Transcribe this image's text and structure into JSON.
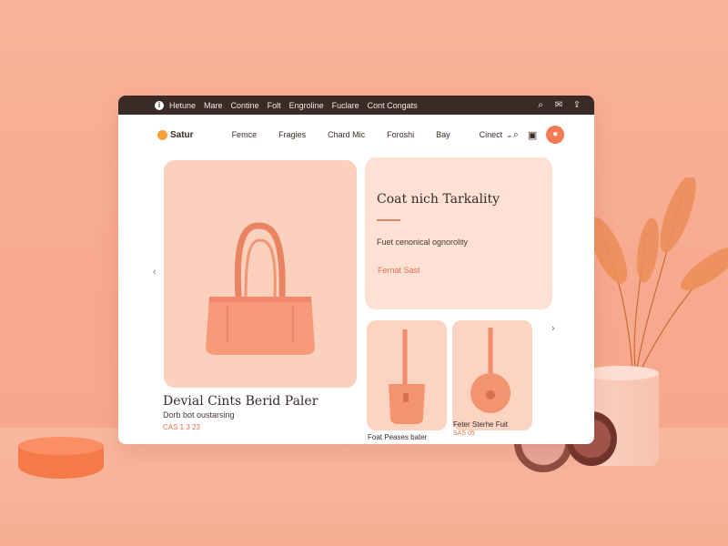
{
  "topbar": {
    "items": [
      "Hetune",
      "Mare",
      "Contine",
      "Folt",
      "Engroline",
      "Fuclare",
      "Cont Congats"
    ],
    "icons": [
      "info-icon",
      "search-icon",
      "mail-icon",
      "share-icon"
    ]
  },
  "navbar": {
    "logo": "Satur",
    "items": [
      "Femce",
      "Fragies",
      "Chard Mic",
      "Foroshi",
      "Bay"
    ],
    "contact": "Cinect",
    "contact_chevron": "⌄",
    "icons": [
      "search-icon",
      "bag-icon",
      "cart-icon"
    ]
  },
  "hero": {
    "product_title": "Devial Cints Berid Paler",
    "product_subtitle": "Dorb bot oustarsing",
    "product_price": "CAS 1 3 23",
    "prev_arrow": "‹",
    "next_arrow": "›"
  },
  "promo": {
    "title": "Coat nich Tarkality",
    "description": "Fuet cenonical ognorolity",
    "link": "Fernat Sast"
  },
  "cards": [
    {
      "label": "Foat Peases bater"
    },
    {
      "label": "Feter Sterhe Fuit",
      "price": "SAS 05"
    }
  ],
  "colors": {
    "accent": "#f47a55",
    "background": "#f9b39a",
    "topbar": "#3a2b29",
    "product": "#f6997a"
  }
}
